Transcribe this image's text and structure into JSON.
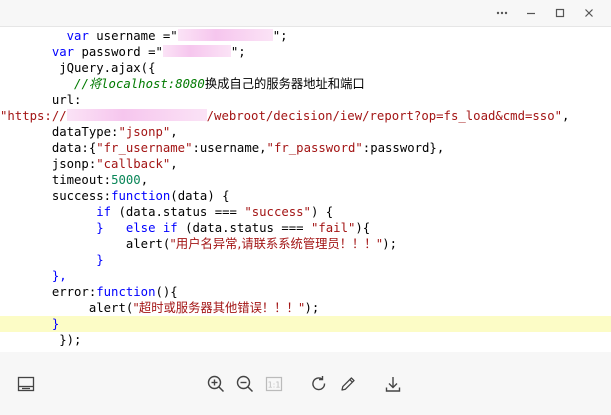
{
  "window": {
    "controls": [
      "more-icon",
      "minimize-icon",
      "maximize-icon",
      "close-icon"
    ]
  },
  "code_lines": [
    {
      "segments": [
        {
          "t": "         "
        },
        {
          "t": "var",
          "c": "kw"
        },
        {
          "t": " username =\"",
          "c": "txt"
        },
        {
          "mask": true,
          "w": 95
        },
        {
          "t": "\";",
          "c": "txt"
        }
      ]
    },
    {
      "segments": [
        {
          "t": "       "
        },
        {
          "t": "var",
          "c": "kw"
        },
        {
          "t": " password =\"",
          "c": "txt"
        },
        {
          "mask": true,
          "w": 68
        },
        {
          "t": "\";",
          "c": "txt"
        }
      ]
    },
    {
      "segments": [
        {
          "t": "        jQuery.ajax({",
          "c": "txt"
        }
      ]
    },
    {
      "segments": [
        {
          "t": "          "
        },
        {
          "t": "//将",
          "c": "cmt"
        },
        {
          "t": "localhost:8080",
          "c": "cmt"
        },
        {
          "t": "换成自己的服务器地址和端口",
          "c": "cmt-zh"
        }
      ]
    },
    {
      "segments": [
        {
          "t": "       url:",
          "c": "txt"
        }
      ]
    },
    {
      "segments": [
        {
          "t": "\"https://",
          "c": "str"
        },
        {
          "mask": true,
          "w": 140
        },
        {
          "t": "/webroot/decision/iew/report?op=fs_load&cmd=sso\"",
          "c": "str"
        },
        {
          "t": ",",
          "c": "txt"
        }
      ]
    },
    {
      "segments": [
        {
          "t": "       dataType:",
          "c": "txt"
        },
        {
          "t": "\"jsonp\"",
          "c": "str"
        },
        {
          "t": ",",
          "c": "txt"
        }
      ]
    },
    {
      "segments": [
        {
          "t": "       data:{",
          "c": "txt"
        },
        {
          "t": "\"fr_username\"",
          "c": "str"
        },
        {
          "t": ":username,",
          "c": "txt"
        },
        {
          "t": "\"fr_password\"",
          "c": "str"
        },
        {
          "t": ":password},",
          "c": "txt"
        }
      ]
    },
    {
      "segments": [
        {
          "t": "       jsonp:",
          "c": "txt"
        },
        {
          "t": "\"callback\"",
          "c": "str"
        },
        {
          "t": ",",
          "c": "txt"
        }
      ]
    },
    {
      "segments": [
        {
          "t": "       timeout:",
          "c": "txt"
        },
        {
          "t": "5000",
          "c": "num"
        },
        {
          "t": ",",
          "c": "txt"
        }
      ]
    },
    {
      "segments": [
        {
          "t": "       success:",
          "c": "txt"
        },
        {
          "t": "function",
          "c": "kw"
        },
        {
          "t": "(data) {",
          "c": "txt"
        }
      ]
    },
    {
      "segments": [
        {
          "t": "             "
        },
        {
          "t": "if",
          "c": "kw"
        },
        {
          "t": " (data.status === ",
          "c": "txt"
        },
        {
          "t": "\"success\"",
          "c": "str"
        },
        {
          "t": ") {",
          "c": "txt"
        }
      ]
    },
    {
      "segments": [
        {
          "t": "             }   ",
          "c": "kw"
        },
        {
          "t": "else if",
          "c": "kw"
        },
        {
          "t": " (data.status === ",
          "c": "txt"
        },
        {
          "t": "\"fail\"",
          "c": "str"
        },
        {
          "t": "){",
          "c": "txt"
        }
      ]
    },
    {
      "segments": [
        {
          "t": "                 alert(",
          "c": "txt"
        },
        {
          "t": "\"用户名异常,请联系系统管理员！！！\"",
          "c": "str zh"
        },
        {
          "t": ");",
          "c": "txt"
        }
      ]
    },
    {
      "segments": [
        {
          "t": "             }",
          "c": "kw"
        }
      ]
    },
    {
      "segments": [
        {
          "t": "       },",
          "c": "kw"
        }
      ]
    },
    {
      "segments": [
        {
          "t": "       error:",
          "c": "txt"
        },
        {
          "t": "function",
          "c": "kw"
        },
        {
          "t": "(){",
          "c": "txt"
        }
      ]
    },
    {
      "segments": [
        {
          "t": "            alert(",
          "c": "txt"
        },
        {
          "t": "\"超时或服务器其他错误！！！\"",
          "c": "str zh"
        },
        {
          "t": ");",
          "c": "txt"
        }
      ]
    },
    {
      "segments": [
        {
          "t": "       }",
          "c": "kw"
        }
      ],
      "highlight": true
    },
    {
      "segments": [
        {
          "t": "        });",
          "c": "txt"
        }
      ]
    }
  ],
  "toolbar": {
    "page_indicator": "1:1"
  }
}
